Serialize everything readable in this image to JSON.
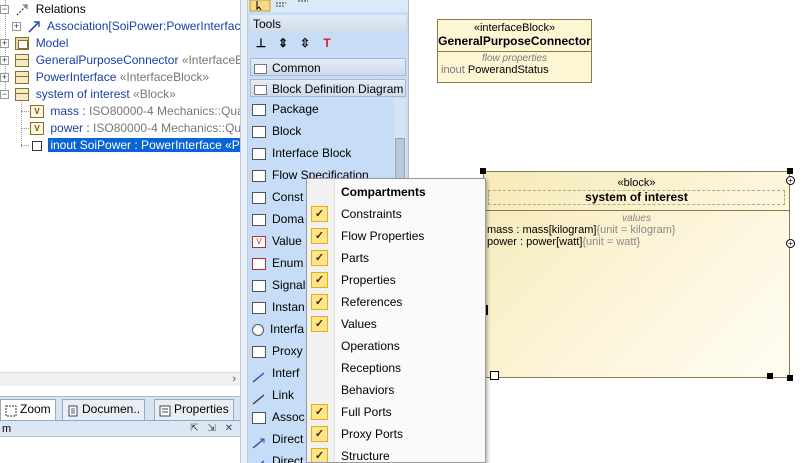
{
  "tree": {
    "items": [
      {
        "label": "Relations",
        "suffix": ""
      },
      {
        "label": "Association[SoiPower:PowerInterfac",
        "suffix": ""
      },
      {
        "label": "Model",
        "suffix": ""
      },
      {
        "label": "GeneralPurposeConnector",
        "suffix": " «InterfaceBl"
      },
      {
        "label": "PowerInterface",
        "suffix": " «InterfaceBlock»"
      },
      {
        "label": "system of interest",
        "suffix": " «Block»"
      },
      {
        "label": "mass : ",
        "suffix": "ISO80000-4 Mechanics::Qua"
      },
      {
        "label": "power : ",
        "suffix": "ISO80000-4 Mechanics::Qua"
      },
      {
        "label": "inout SoiPower : PowerInterface «Pr",
        "suffix": ""
      }
    ]
  },
  "bottom_tabs": [
    {
      "label": "Zoom"
    },
    {
      "label": "Documen.."
    },
    {
      "label": "Properties"
    }
  ],
  "bottom_panel": {
    "title": "m"
  },
  "palette": {
    "tools_header": "Tools",
    "common_header": "Common",
    "bdd_header": "Block Definition Diagram",
    "items": [
      "Package",
      "Block",
      "Interface Block",
      "Flow Specification",
      "Const",
      "Doma",
      "Value",
      "Enum",
      "Signal",
      "Instan",
      "Interfa",
      "Proxy",
      "Interf",
      "Link",
      "Assoc",
      "Direct",
      "Direct"
    ]
  },
  "diagram": {
    "gpc": {
      "stereotype": "«interfaceBlock»",
      "name": "GeneralPurposeConnector",
      "compartment": "flow properties",
      "property_direction": "inout",
      "property_name": "PowerandStatus"
    },
    "soi": {
      "stereotype": "«block»",
      "name": "system of interest",
      "compartment": "values",
      "values": [
        {
          "text": "mass : mass[kilogram]",
          "unit": "{unit = kilogram}"
        },
        {
          "text": "power : power[watt]",
          "unit": "{unit = watt}"
        }
      ]
    }
  },
  "context_menu": {
    "header": "Compartments",
    "items": [
      {
        "label": "Constraints",
        "checked": true
      },
      {
        "label": "Flow Properties",
        "checked": true
      },
      {
        "label": "Parts",
        "checked": true
      },
      {
        "label": "Properties",
        "checked": true
      },
      {
        "label": "References",
        "checked": true
      },
      {
        "label": "Values",
        "checked": true
      },
      {
        "label": "Operations",
        "checked": false
      },
      {
        "label": "Receptions",
        "checked": false
      },
      {
        "label": "Behaviors",
        "checked": false
      },
      {
        "label": "Full Ports",
        "checked": true
      },
      {
        "label": "Proxy Ports",
        "checked": true
      },
      {
        "label": "Structure",
        "checked": true
      }
    ]
  },
  "colors": {
    "selection": "#0a64d6",
    "tree_link": "#1a3fa6",
    "palette_bg": "#c7dcf7",
    "block_fill": "#fdf6d4",
    "check_fill": "#ffe48a"
  }
}
